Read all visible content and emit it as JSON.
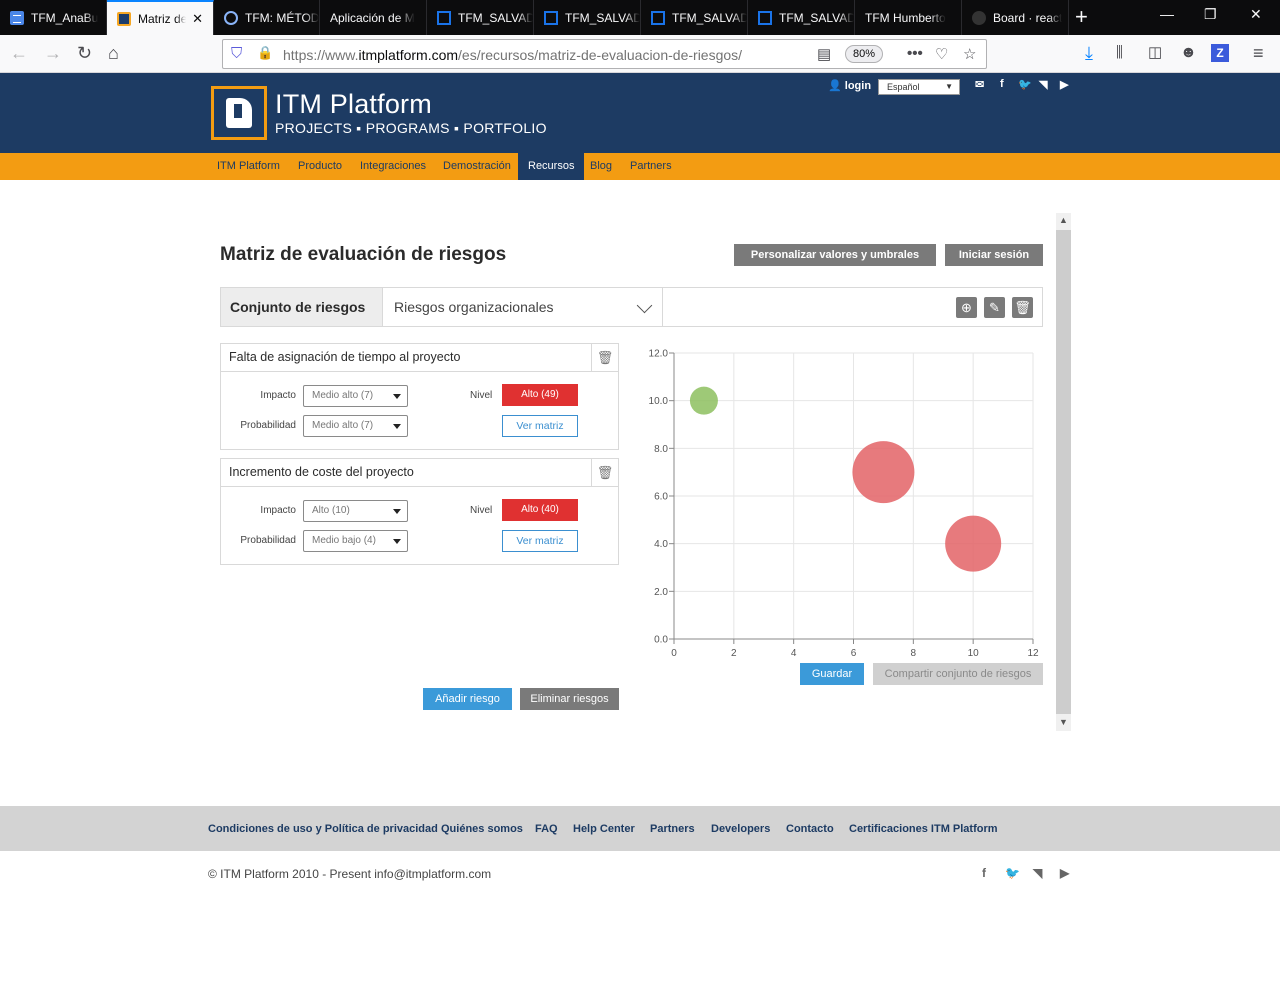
{
  "browser": {
    "tabs": [
      {
        "label": "TFM_AnaBu",
        "icon": "docs-icon",
        "active": false
      },
      {
        "label": "Matriz de",
        "icon": "itm-icon",
        "active": true
      },
      {
        "label": "TFM: MÉTOD",
        "icon": "globe-icon",
        "active": false
      },
      {
        "label": "Aplicación de M",
        "icon": "none",
        "active": false
      },
      {
        "label": "TFM_SALVAD",
        "icon": "pdf-icon",
        "active": false
      },
      {
        "label": "TFM_SALVAD",
        "icon": "pdf-icon",
        "active": false
      },
      {
        "label": "TFM_SALVAD",
        "icon": "pdf-icon",
        "active": false
      },
      {
        "label": "TFM_SALVAD",
        "icon": "pdf-icon",
        "active": false
      },
      {
        "label": "TFM Humberto",
        "icon": "none",
        "active": false
      },
      {
        "label": "Board · react",
        "icon": "github-icon",
        "active": false
      }
    ],
    "url_prefix": "https://www.",
    "url_host": "itmplatform.com",
    "url_path": "/es/recursos/matriz-de-evaluacion-de-riesgos/",
    "zoom": "80%"
  },
  "site": {
    "brand_name": "ITM Platform",
    "brand_tagline": "PROJECTS ▪ PROGRAMS ▪ PORTFOLIO",
    "login_label": "login",
    "language": "Español",
    "menu": [
      "ITM Platform",
      "Producto",
      "Integraciones",
      "Demostración",
      "Recursos",
      "Blog",
      "Partners"
    ],
    "active_menu": "Recursos"
  },
  "matrix": {
    "title": "Matriz de evaluación de riesgos",
    "customize_label": "Personalizar valores y umbrales",
    "signin_label": "Iniciar sesión",
    "set_label": "Conjunto de riesgos",
    "set_value": "Riesgos organizacionales",
    "risks": [
      {
        "name": "Falta de asignación de tiempo al proyecto",
        "impact_label": "Impacto",
        "impact": "Medio alto (7)",
        "prob_label": "Probabilidad",
        "probability": "Medio alto (7)",
        "level_label": "Nivel",
        "level": "Alto (49)",
        "view_label": "Ver matriz"
      },
      {
        "name": "Incremento de coste del proyecto",
        "impact_label": "Impacto",
        "impact": "Alto (10)",
        "prob_label": "Probabilidad",
        "probability": "Medio bajo (4)",
        "level_label": "Nivel",
        "level": "Alto (40)",
        "view_label": "Ver matriz"
      }
    ],
    "add_risk_label": "Añadir riesgo",
    "delete_risks_label": "Eliminar riesgos",
    "save_label": "Guardar",
    "share_label": "Compartir conjunto de riesgos"
  },
  "chart_data": {
    "type": "scatter",
    "xlim": [
      0,
      12
    ],
    "ylim": [
      0,
      12
    ],
    "x_ticks": [
      "0",
      "2",
      "4",
      "6",
      "8",
      "10",
      "12"
    ],
    "y_ticks": [
      "0.0",
      "2.0",
      "4.0",
      "6.0",
      "8.0",
      "10.0",
      "12.0"
    ],
    "grid": true,
    "points": [
      {
        "x": 1,
        "y": 10,
        "size": 1,
        "color": "#8dbf5f"
      },
      {
        "x": 7,
        "y": 7,
        "size": 49,
        "color": "#e36366"
      },
      {
        "x": 10,
        "y": 4,
        "size": 40,
        "color": "#e36366"
      }
    ]
  },
  "footer": {
    "links": [
      "Condiciones de uso y Política de privacidad",
      "Quiénes somos",
      "FAQ",
      "Help Center",
      "Partners",
      "Developers",
      "Contacto",
      "Certificaciones ITM Platform"
    ],
    "copyright": "© ITM Platform 2010 - Present info@itmplatform.com"
  },
  "colors": {
    "header_bg": "#1d3b63",
    "menu_bg": "#f39c12",
    "level_high": "#e03131",
    "action_blue": "#3b9ad9"
  }
}
